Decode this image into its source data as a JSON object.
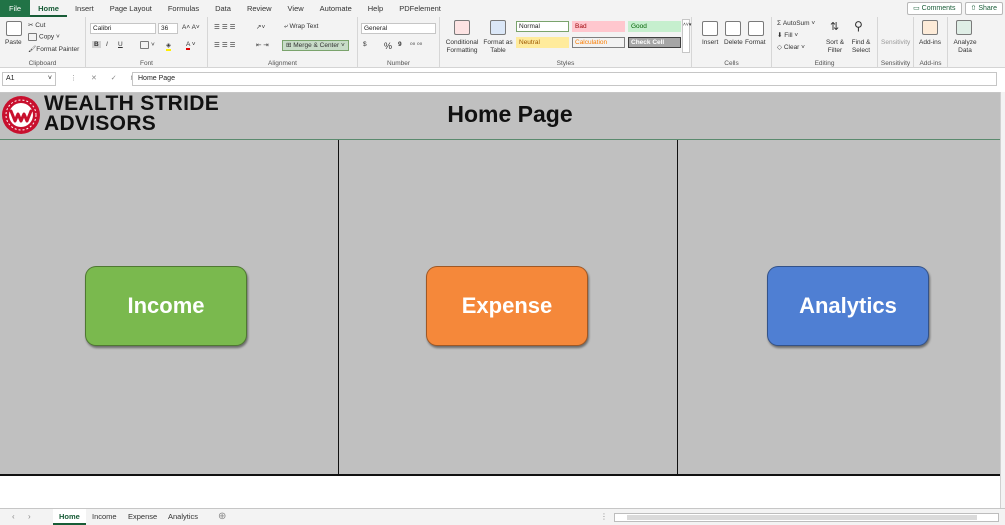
{
  "ribbon_tabs": [
    "File",
    "Home",
    "Insert",
    "Page Layout",
    "Formulas",
    "Data",
    "Review",
    "View",
    "Automate",
    "Help",
    "PDFelement"
  ],
  "active_tab": "Home",
  "top_right": {
    "comments": "Comments",
    "share": "Share"
  },
  "clipboard": {
    "paste": "Paste",
    "cut": "Cut",
    "copy": "Copy",
    "format_painter": "Format Painter",
    "label": "Clipboard"
  },
  "font": {
    "family": "Calibri",
    "size": "36",
    "bold": "B",
    "italic": "I",
    "underline": "U",
    "color_a": "A",
    "grow": "A˄",
    "shrink": "A˅",
    "label": "Font"
  },
  "alignment": {
    "wrap": "Wrap Text",
    "merge": "Merge & Center",
    "label": "Alignment"
  },
  "number": {
    "format": "General",
    "currency": "$",
    "percent": "%",
    "comma": "9",
    "label": "Number"
  },
  "styles_group": {
    "conditional": "Conditional Formatting",
    "format_table": "Format as Table",
    "cells": [
      {
        "text": "Normal",
        "bg": "#ffffff",
        "fg": "#222222",
        "border": "#7aa36c"
      },
      {
        "text": "Bad",
        "bg": "#ffc7ce",
        "fg": "#9c0006",
        "border": "#ffc7ce"
      },
      {
        "text": "Good",
        "bg": "#c6efce",
        "fg": "#006100",
        "border": "#c6efce"
      },
      {
        "text": "Neutral",
        "bg": "#ffeb9c",
        "fg": "#9c5700",
        "border": "#ffeb9c"
      },
      {
        "text": "Calculation",
        "bg": "#f2f2f2",
        "fg": "#fa7d00",
        "border": "#7f7f7f"
      },
      {
        "text": "Check Cell",
        "bg": "#a5a5a5",
        "fg": "#ffffff",
        "border": "#3f3f3f"
      }
    ],
    "label": "Styles"
  },
  "cells_group": {
    "insert": "Insert",
    "delete": "Delete",
    "format": "Format",
    "label": "Cells"
  },
  "editing": {
    "autosum": "AutoSum",
    "fill": "Fill",
    "clear": "Clear",
    "sort": "Sort & Filter",
    "find": "Find & Select",
    "label": "Editing"
  },
  "sensitivity": {
    "text": "Sensitivity",
    "label": "Sensitivity"
  },
  "addins": {
    "text": "Add-ins",
    "label": "Add-ins"
  },
  "analyze": {
    "text": "Analyze Data"
  },
  "formula_bar": {
    "name_box": "A1",
    "fx": "fx",
    "content": "Home Page"
  },
  "sheet": {
    "brand_line1": "WEALTH STRIDE",
    "brand_line2": "ADVISORS",
    "title": "Home Page",
    "buttons": [
      {
        "label": "Income",
        "color": "#7ab94e"
      },
      {
        "label": "Expense",
        "color": "#f5883a"
      },
      {
        "label": "Analytics",
        "color": "#4f7fd3"
      }
    ]
  },
  "sheet_tabs": [
    "Home",
    "Income",
    "Expense",
    "Analytics"
  ],
  "active_sheet": "Home",
  "colors": {
    "excel_green": "#217346",
    "band_gray": "#c0c0c0",
    "logo_red": "#c8102e"
  }
}
